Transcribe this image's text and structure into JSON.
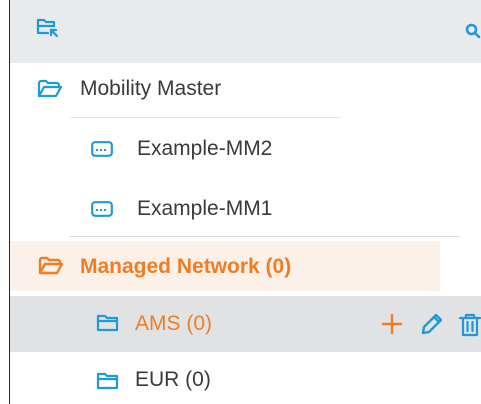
{
  "colors": {
    "accent": "#1e9ad6",
    "highlight_orange": "#f37c22",
    "header_bg": "#e9eaec",
    "selected_row_bg": "#e1e2e4",
    "hover_row_bg": "#fbf1e8",
    "text": "#3a3a3a"
  },
  "header": {
    "left_icon": "folder-select-icon",
    "right_icon": "search-icon"
  },
  "tree": {
    "root": {
      "label": "Mobility Master",
      "icon": "folder-open-icon"
    },
    "devices": [
      {
        "label": "Example-MM2",
        "icon": "device-icon"
      },
      {
        "label": "Example-MM1",
        "icon": "device-icon"
      }
    ],
    "managed": {
      "label": "Managed Network (0)",
      "icon": "folder-open-icon"
    },
    "groups": [
      {
        "label": "AMS (0)",
        "icon": "folder-icon",
        "actions": [
          {
            "name": "add",
            "icon": "plus-icon"
          },
          {
            "name": "edit",
            "icon": "pencil-icon"
          },
          {
            "name": "delete",
            "icon": "trash-icon"
          }
        ]
      },
      {
        "label": "EUR (0)",
        "icon": "folder-icon"
      }
    ]
  }
}
